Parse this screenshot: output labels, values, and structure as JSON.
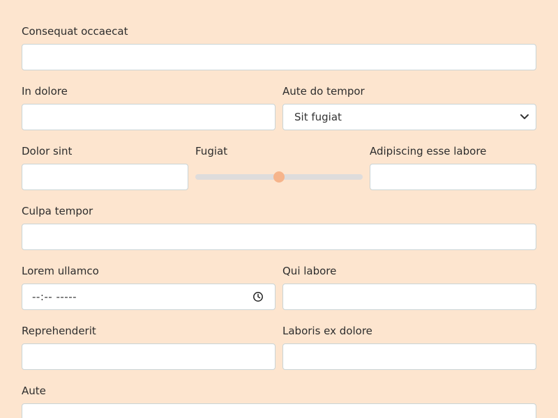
{
  "form": {
    "fields": {
      "consequat": {
        "label": "Consequat occaecat",
        "value": ""
      },
      "in_dolore": {
        "label": "In dolore",
        "value": ""
      },
      "aute_do_tempor": {
        "label": "Aute do tempor",
        "selected": "Sit fugiat"
      },
      "dolor_sint": {
        "label": "Dolor sint",
        "value": ""
      },
      "fugiat": {
        "label": "Fugiat",
        "level": 0.5
      },
      "adipiscing": {
        "label": "Adipiscing esse labore",
        "value": ""
      },
      "culpa_tempor": {
        "label": "Culpa tempor",
        "value": ""
      },
      "lorem_ullamco": {
        "label": "Lorem ullamco",
        "value": "--:-- -----"
      },
      "qui_labore": {
        "label": "Qui labore",
        "value": ""
      },
      "reprehenderit": {
        "label": "Reprehenderit",
        "value": ""
      },
      "laboris": {
        "label": "Laboris ex dolore",
        "value": ""
      },
      "aute": {
        "label": "Aute",
        "value": ""
      }
    }
  },
  "colors": {
    "background": "#fde5cf",
    "slider_thumb": "#f6b48b",
    "slider_track": "#dedcdc",
    "input_border": "#c9d4d6"
  },
  "icons": {
    "select": "chevron-down-icon",
    "time": "clock-icon"
  }
}
